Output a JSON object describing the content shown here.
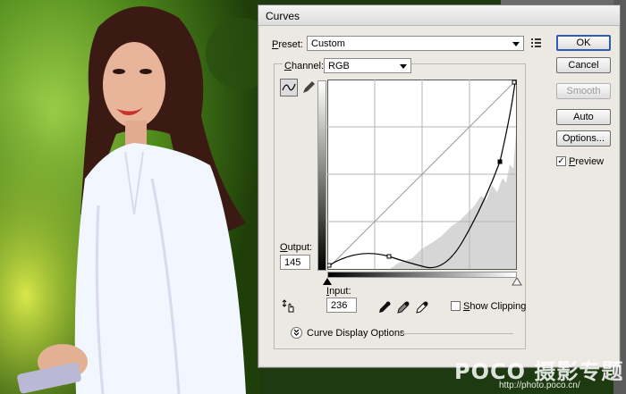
{
  "dialog": {
    "title": "Curves",
    "preset_label": "Preset:",
    "preset_value": "Custom",
    "channel_label": "Channel:",
    "channel_value": "RGB",
    "output_label": "Output:",
    "output_value": "145",
    "input_label": "Input:",
    "input_value": "236",
    "show_clipping_label": "Show Clipping",
    "show_clipping_checked": false,
    "curve_display_options_label": "Curve Display Options",
    "buttons": {
      "ok": "OK",
      "cancel": "Cancel",
      "smooth": "Smooth",
      "auto": "Auto",
      "options": "Options..."
    },
    "preview_label": "Preview",
    "preview_checked": true
  },
  "watermark": {
    "brand": "POCO 摄影专题",
    "url": "http://photo.poco.cn/"
  },
  "icons": {
    "curve_tool": "curve-icon",
    "pencil_tool": "pencil-icon",
    "preset_menu": "list-menu-icon",
    "hand_tool": "target-hand-icon",
    "eyedroppers": [
      "black-eyedropper-icon",
      "gray-eyedropper-icon",
      "white-eyedropper-icon"
    ],
    "expand": "double-chevron-down-icon"
  }
}
